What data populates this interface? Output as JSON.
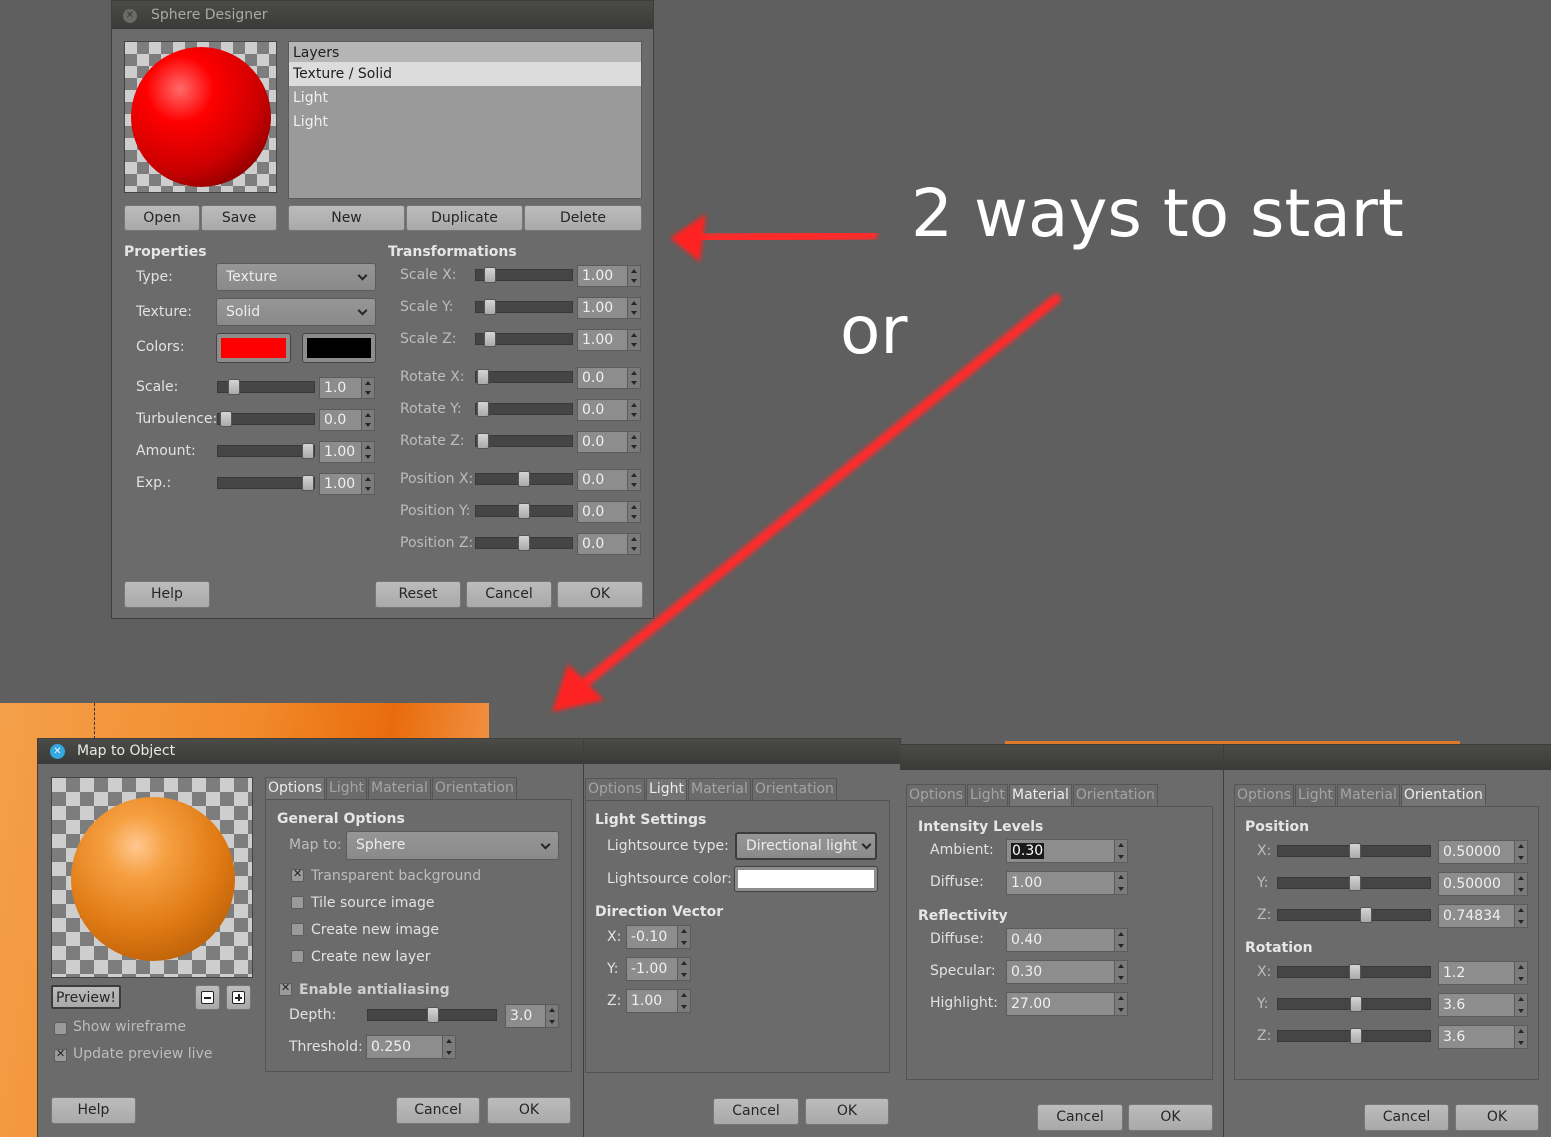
{
  "annotation": {
    "headline": "2 ways to start",
    "or_text": "or",
    "arrow_color": "#ff1a1a"
  },
  "sphere_designer": {
    "title": "Sphere Designer",
    "layers": [
      "Layers",
      "Texture / Solid",
      "Light",
      "Light"
    ],
    "buttons": {
      "open": "Open",
      "save": "Save",
      "new": "New",
      "duplicate": "Duplicate",
      "delete": "Delete",
      "help": "Help",
      "reset": "Reset",
      "cancel": "Cancel",
      "ok": "OK"
    },
    "properties": {
      "header": "Properties",
      "type_label": "Type:",
      "type_value": "Texture",
      "texture_label": "Texture:",
      "texture_value": "Solid",
      "colors_label": "Colors:",
      "color1": "#ff0000",
      "color2": "#000000",
      "scale_label": "Scale:",
      "scale_value": "1.0",
      "turbulence_label": "Turbulence:",
      "turbulence_value": "0.0",
      "amount_label": "Amount:",
      "amount_value": "1.00",
      "exp_label": "Exp.:",
      "exp_value": "1.00"
    },
    "transformations": {
      "header": "Transformations",
      "rows": [
        {
          "label": "Scale X:",
          "value": "1.00"
        },
        {
          "label": "Scale Y:",
          "value": "1.00"
        },
        {
          "label": "Scale Z:",
          "value": "1.00"
        },
        {
          "label": "Rotate X:",
          "value": "0.0"
        },
        {
          "label": "Rotate Y:",
          "value": "0.0"
        },
        {
          "label": "Rotate Z:",
          "value": "0.0"
        },
        {
          "label": "Position X:",
          "value": "0.0"
        },
        {
          "label": "Position Y:",
          "value": "0.0"
        },
        {
          "label": "Position Z:",
          "value": "0.0"
        }
      ]
    }
  },
  "map_to_object": {
    "title": "Map to Object",
    "tabs": [
      "Options",
      "Light",
      "Material",
      "Orientation"
    ],
    "preview_button": "Preview!",
    "zoom_out": "−",
    "zoom_in": "+",
    "show_wireframe": "Show wireframe",
    "update_preview_live": "Update preview live",
    "general_options": "General Options",
    "map_to_label": "Map to:",
    "map_to_value": "Sphere",
    "transparent_background": "Transparent background",
    "tile_source_image": "Tile source image",
    "create_new_image": "Create new image",
    "create_new_layer": "Create new layer",
    "enable_antialiasing": "Enable antialiasing",
    "depth_label": "Depth:",
    "depth_value": "3.0",
    "threshold_label": "Threshold:",
    "threshold_value": "0.250",
    "help": "Help",
    "cancel": "Cancel",
    "ok": "OK"
  },
  "light_panel": {
    "header": "Light Settings",
    "type_label": "Lightsource type:",
    "type_value": "Directional light",
    "color_label": "Lightsource color:",
    "color_value": "#ffffff",
    "direction_header": "Direction Vector",
    "x_label": "X:",
    "x_value": "-0.10",
    "y_label": "Y:",
    "y_value": "-1.00",
    "z_label": "Z:",
    "z_value": "1.00",
    "cancel": "Cancel",
    "ok": "OK"
  },
  "material_panel": {
    "intensity_header": "Intensity Levels",
    "ambient_label": "Ambient:",
    "ambient_value": "0.30",
    "diffuse_label": "Diffuse:",
    "diffuse_value": "1.00",
    "reflectivity_header": "Reflectivity",
    "r_diffuse_label": "Diffuse:",
    "r_diffuse_value": "0.40",
    "specular_label": "Specular:",
    "specular_value": "0.30",
    "highlight_label": "Highlight:",
    "highlight_value": "27.00",
    "cancel": "Cancel",
    "ok": "OK"
  },
  "orientation_panel": {
    "position_header": "Position",
    "pos": [
      {
        "label": "X:",
        "value": "0.50000"
      },
      {
        "label": "Y:",
        "value": "0.50000"
      },
      {
        "label": "Z:",
        "value": "0.74834"
      }
    ],
    "rotation_header": "Rotation",
    "rot": [
      {
        "label": "X:",
        "value": "1.2"
      },
      {
        "label": "Y:",
        "value": "3.6"
      },
      {
        "label": "Z:",
        "value": "3.6"
      }
    ],
    "cancel": "Cancel",
    "ok": "OK"
  }
}
